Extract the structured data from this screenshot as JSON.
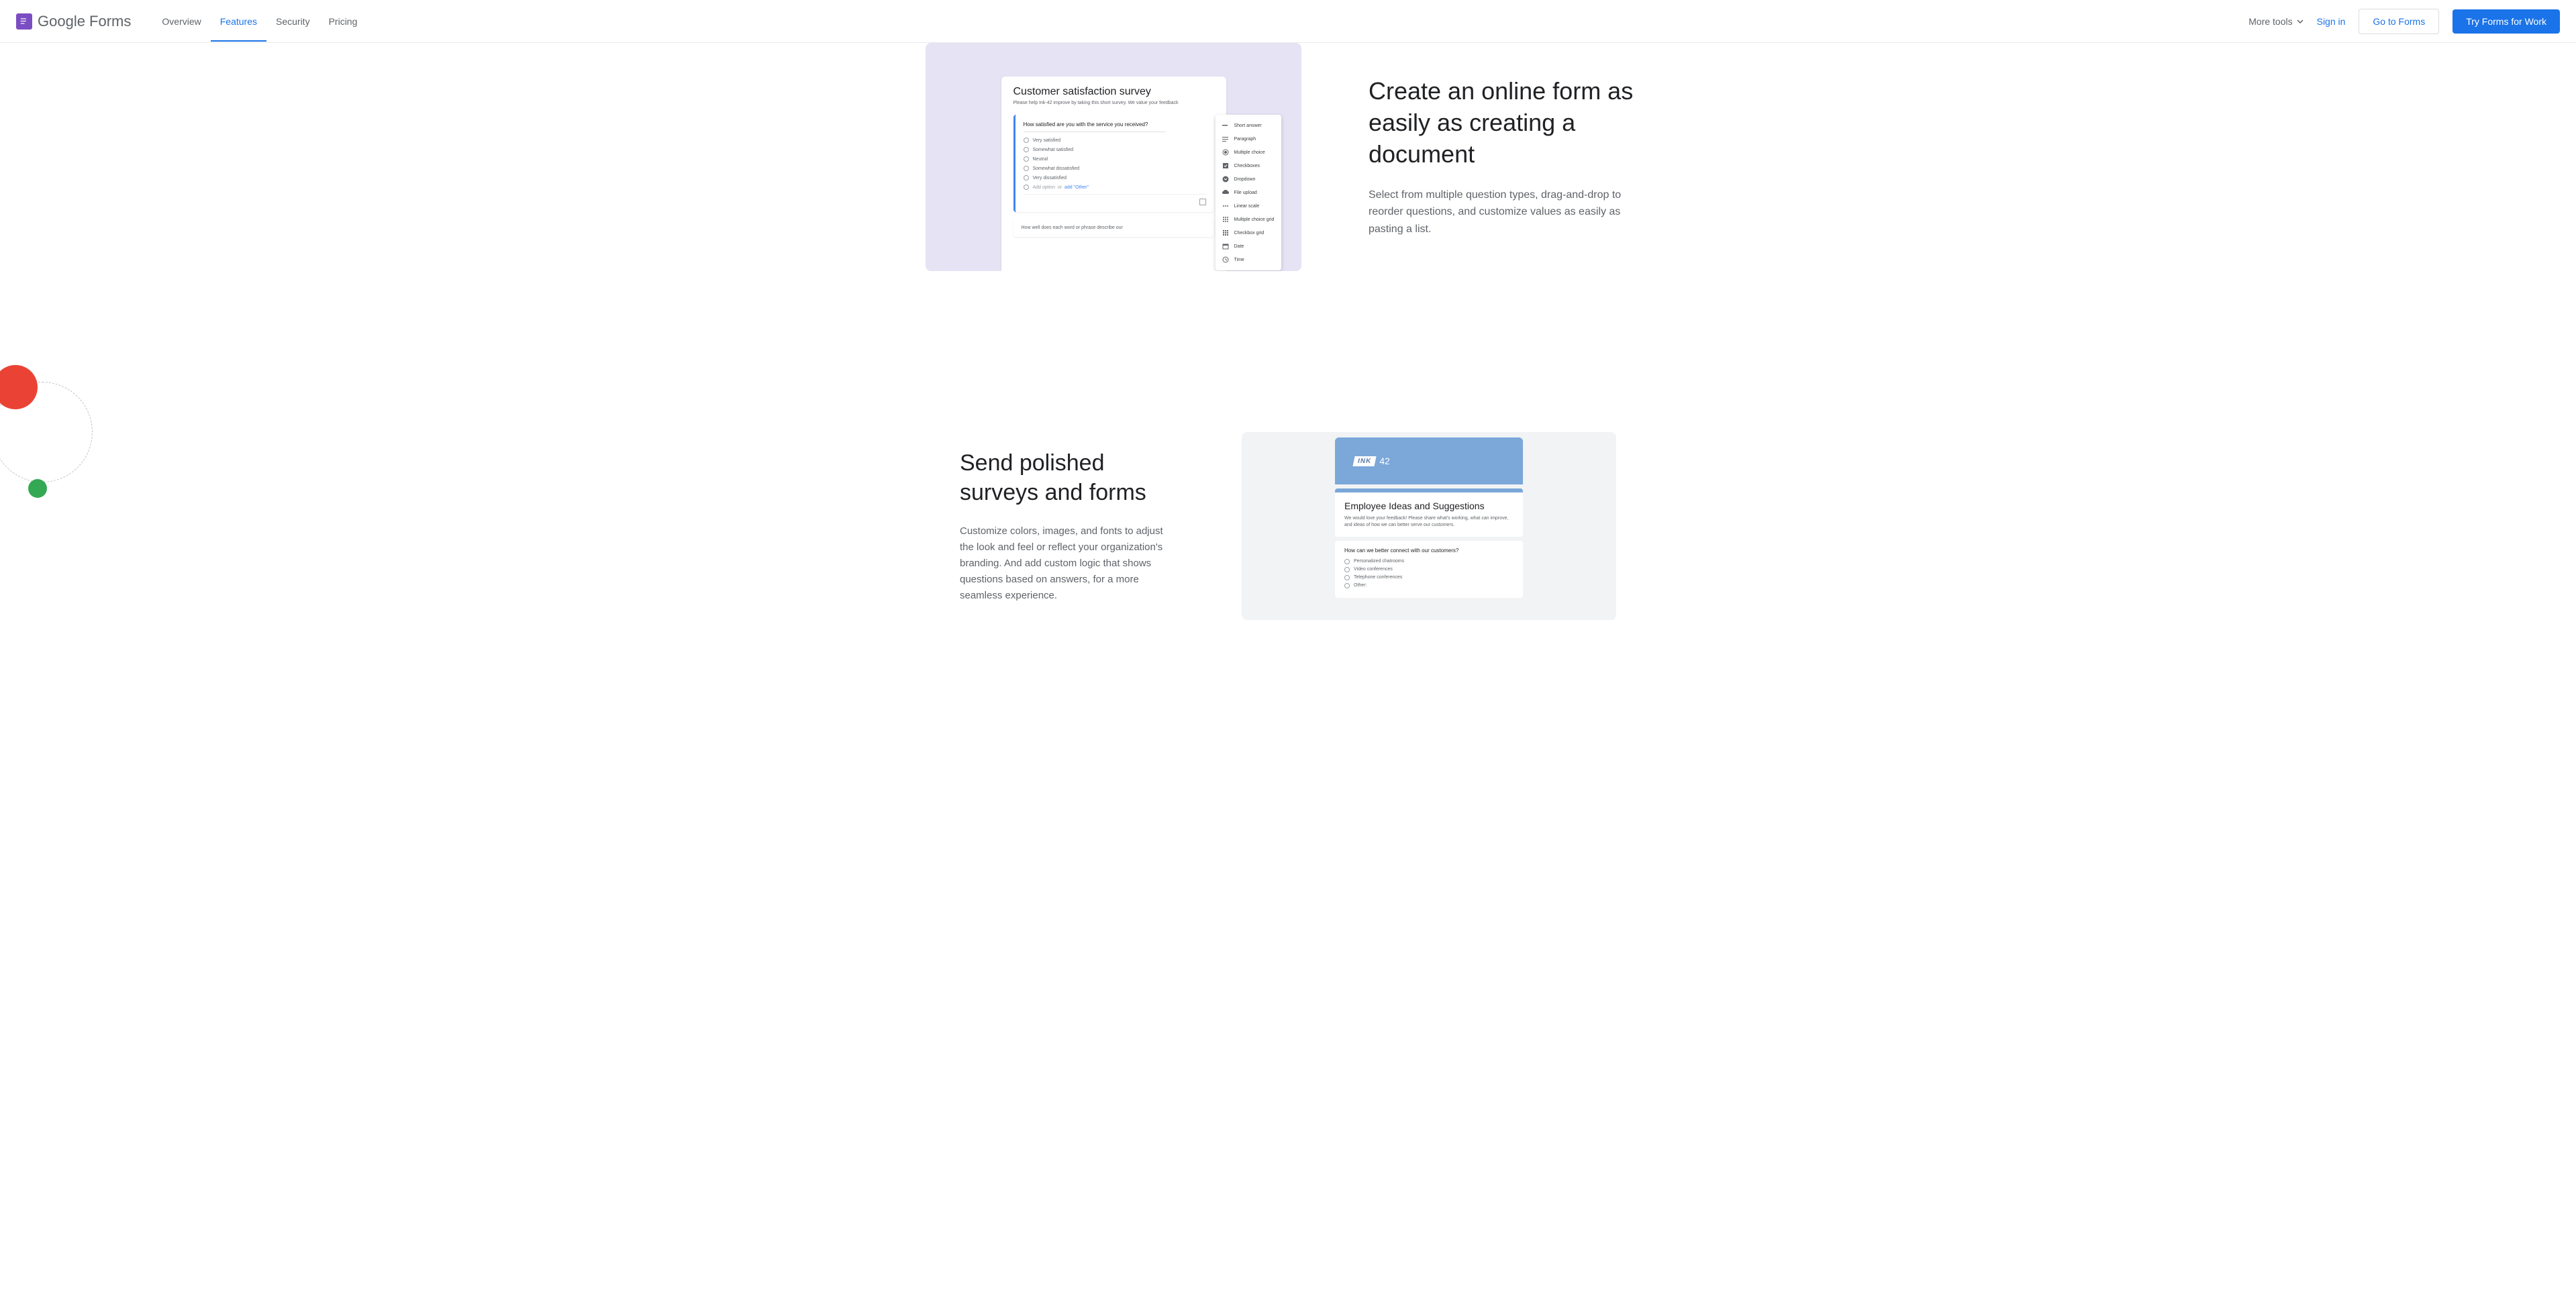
{
  "header": {
    "logo_text": "Google Forms",
    "nav": {
      "overview": "Overview",
      "features": "Features",
      "security": "Security",
      "pricing": "Pricing"
    },
    "more_tools": "More tools",
    "signin": "Sign in",
    "go_to_forms": "Go to Forms",
    "try_for_work": "Try Forms for Work"
  },
  "section1": {
    "heading": "Create an online form as easily as creating a document",
    "body": "Select from multiple question types, drag-and-drop to reorder questions, and customize values as easily as pasting a list.",
    "mock": {
      "title": "Customer satisfaction survey",
      "desc": "Please help Ink-42 improve by taking this short survey. We value your feedback",
      "question": "How satisfied are you with the service you received?",
      "opts": {
        "o1": "Very satisfied",
        "o2": "Somewhat satisfied",
        "o3": "Neutral",
        "o4": "Somewhat dissatisfied",
        "o5": "Very dissatisfied"
      },
      "add_option": "Add option",
      "or": "or",
      "add_other": "add \"Other\"",
      "q2": "How well does each word or phrase describe our",
      "dropdown": {
        "d1": "Short answer",
        "d2": "Paragraph",
        "d3": "Multiple choice",
        "d4": "Checkboxes",
        "d5": "Dropdown",
        "d6": "File upload",
        "d7": "Linear scale",
        "d8": "Multiple choice grid",
        "d9": "Checkbox grid",
        "d10": "Date",
        "d11": "Time"
      }
    }
  },
  "section2": {
    "heading": "Send polished surveys and forms",
    "body": "Customize colors, images, and fonts to adjust the look and feel or reflect your organization's branding. And add custom logic that shows questions based on answers, for a more seamless experience.",
    "mock": {
      "ink": "INK",
      "num42": "42",
      "title": "Employee Ideas and Suggestions",
      "desc": "We would love your feedback! Please share what's working, what can improve, and ideas of how we can better serve our customers.",
      "question": "How can we better connect with our customers?",
      "opts": {
        "o1": "Personalized chatrooms",
        "o2": "Video conferences",
        "o3": "Telephone conferences",
        "o4": "Other:"
      }
    }
  }
}
